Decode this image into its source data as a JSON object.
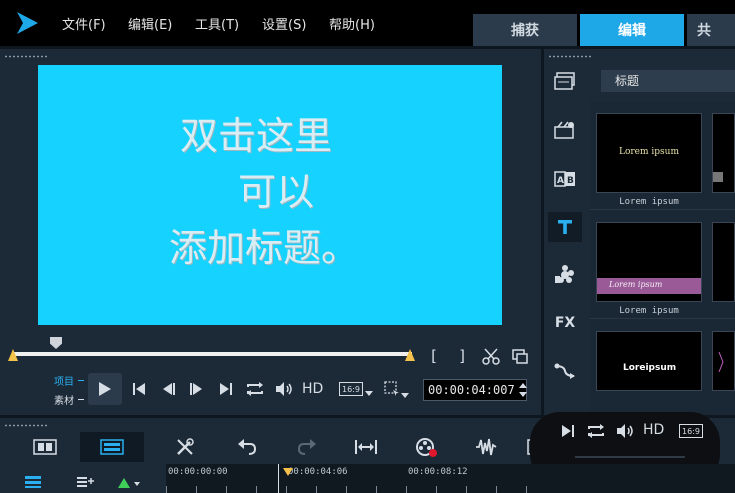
{
  "menu": {
    "file": "文件(F)",
    "edit": "编辑(E)",
    "tools": "工具(T)",
    "settings": "设置(S)",
    "help": "帮助(H)"
  },
  "tabs": {
    "capture": "捕获",
    "edit": "编辑",
    "share_partial": "共"
  },
  "preview": {
    "line1": "双击这里",
    "line2": "可以",
    "line3": "添加标题。",
    "background": "#16d2ff"
  },
  "player": {
    "mode_project": "项目",
    "mode_clip": "素材",
    "hd_label": "HD",
    "aspect": "16:9",
    "timecode": "00:00:04:007",
    "scrub_position": 0.11
  },
  "library": {
    "category": "标题",
    "fx_label": "FX",
    "thumbs": [
      {
        "label": "Lorem ipsum",
        "preview_text": "Lorem ipsum"
      },
      {
        "label": "Lorem ipsum",
        "preview_text": "Lorem ipsum"
      },
      {
        "label": "",
        "preview_text": "Loreipsum"
      }
    ]
  },
  "toolbar": {
    "hd_label": "HD",
    "aspect": "16:9"
  },
  "timeline": {
    "ruler": [
      "00:00:00:00",
      "00:00:04:06",
      "00:00:08:12"
    ]
  },
  "colors": {
    "accent": "#1fa8e8",
    "panel": "#1c2a38",
    "scrub_marker": "#f4c24a"
  }
}
